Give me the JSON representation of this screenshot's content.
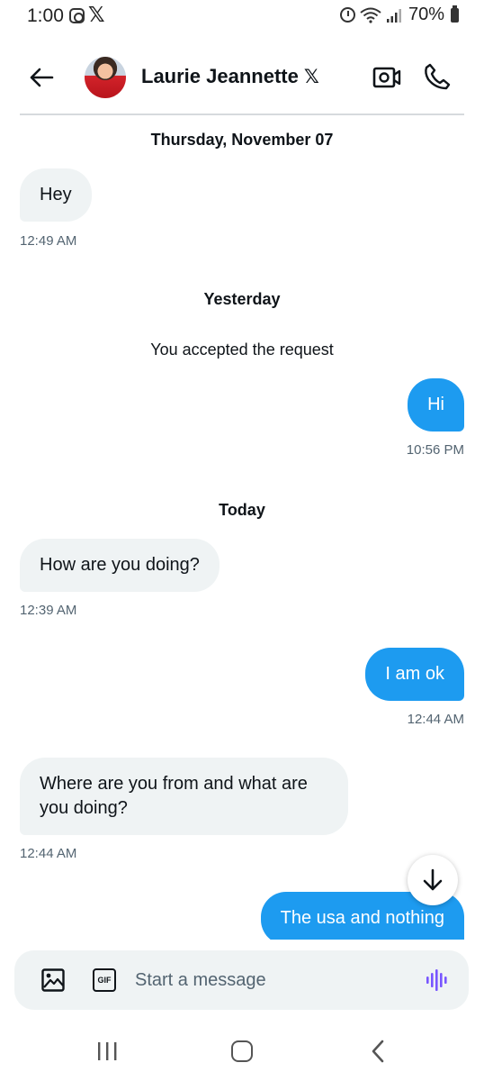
{
  "status_bar": {
    "time": "1:00",
    "battery": "70%",
    "icons": [
      "instagram-icon",
      "x-logo-icon",
      "alarm-icon",
      "wifi-icon",
      "signal-icon",
      "battery-icon"
    ]
  },
  "header": {
    "contact_name": "Laurie Jeannette",
    "verified_glyph": "𝕏",
    "icons": [
      "back-arrow-icon",
      "avatar",
      "video-call-icon",
      "phone-call-icon"
    ]
  },
  "conversation": {
    "sections": [
      {
        "date": "Thursday, November 07"
      },
      {
        "date": "Yesterday",
        "system": "You accepted the request"
      },
      {
        "date": "Today"
      }
    ],
    "messages": [
      {
        "direction": "in",
        "text": "Hey",
        "time": "12:49 AM"
      },
      {
        "direction": "out",
        "text": "Hi",
        "time": "10:56 PM"
      },
      {
        "direction": "in",
        "text": "How are you doing?",
        "time": "12:39 AM"
      },
      {
        "direction": "out",
        "text": "I am ok",
        "time": "12:44 AM"
      },
      {
        "direction": "in",
        "text": "Where are you from and what  are you doing?",
        "time": "12:44 AM"
      },
      {
        "direction": "out",
        "text": "The usa and nothing",
        "time": ""
      }
    ]
  },
  "composer": {
    "placeholder": "Start a message",
    "gif_label": "GIF",
    "accent_color": "#1d9bf0",
    "voice_color": "#7856ff"
  },
  "colors": {
    "outgoing_bubble": "#1d9bf0",
    "incoming_bubble": "#eff3f4",
    "text": "#0f1419",
    "secondary_text": "#536471"
  }
}
